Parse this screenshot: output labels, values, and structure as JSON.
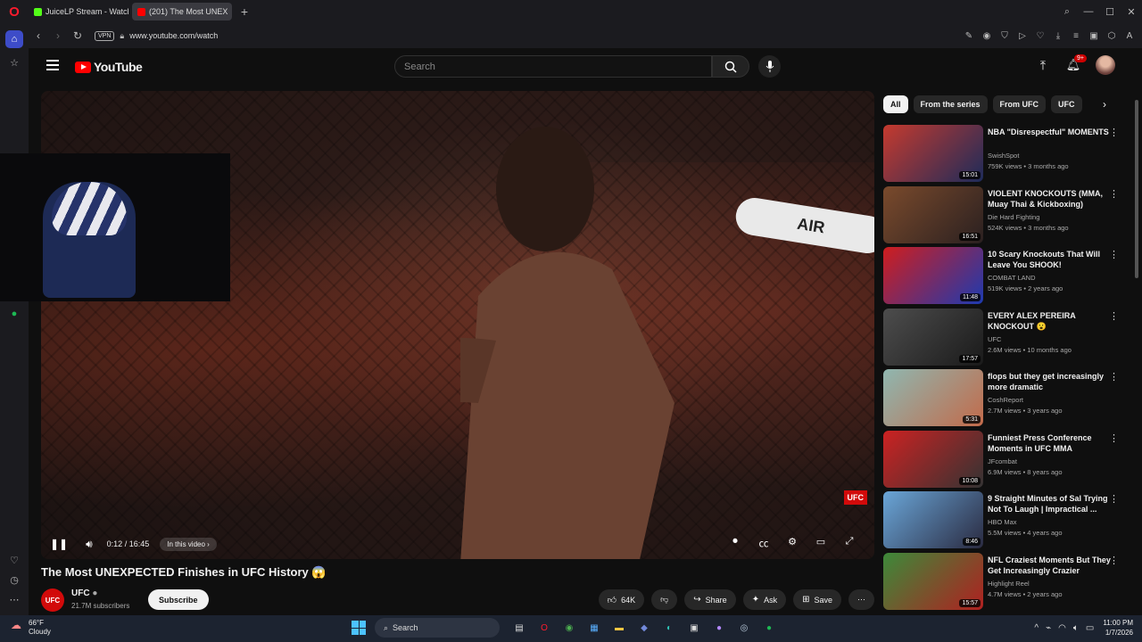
{
  "browser": {
    "tabs": [
      {
        "title": "JuiceLP Stream - Watch Li",
        "color": "#53fc18",
        "active": false
      },
      {
        "title": "(201) The Most UNEX",
        "color": "#ff0000",
        "active": true
      }
    ],
    "new_tab": "+",
    "url": "www.youtube.com/watch",
    "vpn": "VPN"
  },
  "youtube": {
    "logo": "YouTube",
    "search_placeholder": "Search",
    "notifications_badge": "9+",
    "video": {
      "time": "0:12 / 16:45",
      "chapter": "In this video",
      "progress_fraction": 0.012,
      "ufc_bug": "UFC",
      "pad_text": "AIR"
    },
    "title": "The Most UNEXPECTED Finishes in UFC History 😱",
    "channel": {
      "name": "UFC",
      "subs": "21.7M subscribers",
      "avatar": "UFC"
    },
    "subscribe": "Subscribe",
    "actions": [
      {
        "icon": "like-icon",
        "label": "64K"
      },
      {
        "icon": "dislike-icon",
        "label": ""
      },
      {
        "icon": "share-icon",
        "label": "Share"
      },
      {
        "icon": "ask-icon",
        "label": "Ask"
      },
      {
        "icon": "save-icon",
        "label": "Save"
      },
      {
        "icon": "more-icon",
        "label": "⋯"
      }
    ],
    "chips": [
      "All",
      "From the series",
      "From UFC",
      "UFC"
    ],
    "recommendations": [
      {
        "title": "NBA \"Disrespectful\" MOMENTS",
        "channel": "SwishSpot",
        "meta": "759K views • 3 months ago",
        "duration": "15:01",
        "colors": [
          "#c53a2e",
          "#1d2b5a"
        ]
      },
      {
        "title": "VIOLENT KNOCKOUTS (MMA, Muay Thai & Kickboxing)",
        "channel": "Die Hard Fighting",
        "meta": "524K views • 3 months ago",
        "duration": "16:51",
        "colors": [
          "#7a4a2c",
          "#2a2020"
        ]
      },
      {
        "title": "10 Scary Knockouts That Will Leave You SHOOK!",
        "channel": "COMBAT LAND",
        "meta": "519K views • 2 years ago",
        "duration": "11:48",
        "colors": [
          "#d01d1d",
          "#1d3ab0"
        ]
      },
      {
        "title": "EVERY ALEX PEREIRA KNOCKOUT 😮",
        "channel": "UFC",
        "meta": "2.6M views • 10 months ago",
        "duration": "17:57",
        "colors": [
          "#4d4d4d",
          "#1a1a1a"
        ]
      },
      {
        "title": "flops but they get increasingly more dramatic",
        "channel": "CoshReport",
        "meta": "2.7M views • 3 years ago",
        "duration": "5:31",
        "colors": [
          "#8fb7b0",
          "#c26a4a"
        ]
      },
      {
        "title": "Funniest Press Conference Moments in UFC MMA",
        "channel": "JFcombat",
        "meta": "6.9M views • 8 years ago",
        "duration": "10:08",
        "colors": [
          "#cc2222",
          "#333333"
        ]
      },
      {
        "title": "9 Straight Minutes of Sal Trying Not To Laugh | Impractical ...",
        "channel": "HBO Max",
        "meta": "5.5M views • 4 years ago",
        "duration": "8:46",
        "colors": [
          "#6aa6d8",
          "#2a2a40"
        ]
      },
      {
        "title": "NFL Craziest Moments But They Get Increasingly Crazier",
        "channel": "Highlight Reel",
        "meta": "4.7M views • 2 years ago",
        "duration": "15:57",
        "colors": [
          "#3c8a3a",
          "#b02020"
        ]
      }
    ]
  },
  "taskbar": {
    "weather_temp": "66°F",
    "weather_desc": "Cloudy",
    "search": "Search",
    "time": "11:00 PM",
    "date": "1/7/2026"
  }
}
